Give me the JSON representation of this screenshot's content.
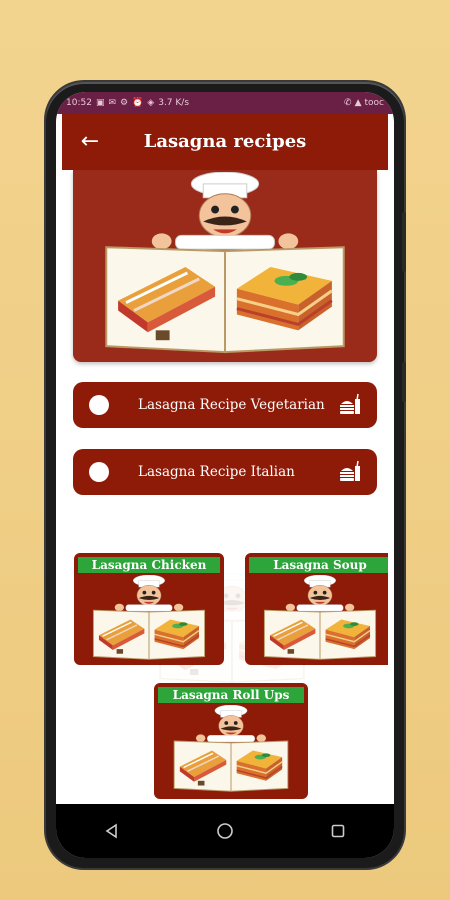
{
  "status_bar": {
    "time": "10:52",
    "speed": "3.7 K/s",
    "carrier": "tooc",
    "left_icons": [
      "notification-icon",
      "mail-icon",
      "settings-icon",
      "alarm-icon",
      "shield-icon"
    ],
    "right_icons": [
      "phone-icon",
      "signal-icon"
    ]
  },
  "app_bar": {
    "title": "Lasagna recipes",
    "back_icon": "arrow-left-icon"
  },
  "list": [
    {
      "label": "Lasagna Recipe Vegetarian",
      "icon": "burger-drink-icon"
    },
    {
      "label": "Lasagna Recipe Italian",
      "icon": "burger-drink-icon"
    }
  ],
  "cards": [
    {
      "label": "Lasagna Chicken"
    },
    {
      "label": "Lasagna Soup"
    },
    {
      "label": "Lasagna Roll Ups"
    }
  ],
  "nav_bar": {
    "icons": [
      "back-triangle-icon",
      "home-circle-icon",
      "recents-square-icon"
    ]
  },
  "colors": {
    "primary": "#8e1b08",
    "label_green": "#2da53a",
    "background": "#f0cf86"
  }
}
